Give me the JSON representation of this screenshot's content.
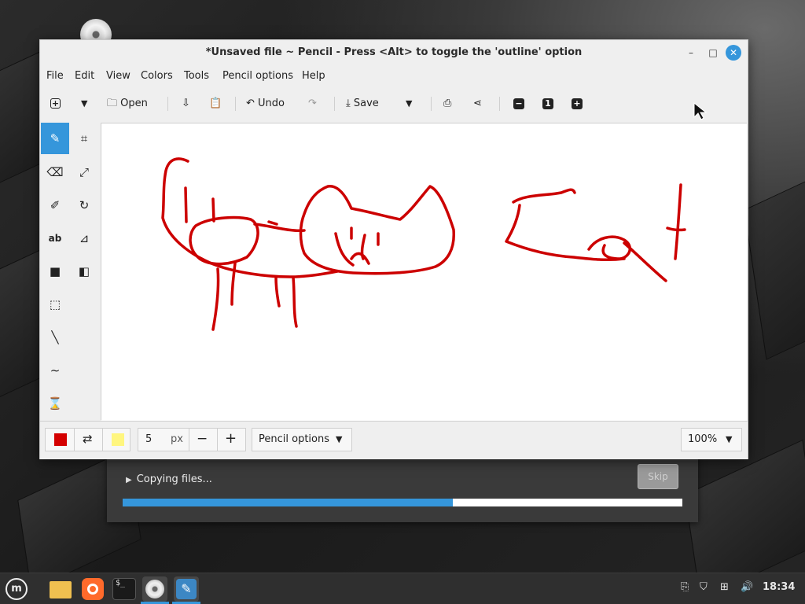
{
  "window": {
    "title": "*Unsaved file ~ Pencil - Press <Alt> to toggle the 'outline' option",
    "minimize": "–",
    "maximize": "□",
    "close": "✕"
  },
  "menu": [
    "File",
    "Edit",
    "View",
    "Colors",
    "Tools",
    "Pencil options",
    "Help"
  ],
  "toolbar": {
    "open": "Open",
    "undo": "Undo",
    "save": "Save"
  },
  "tools": [
    {
      "name": "pencil",
      "icon": "✎"
    },
    {
      "name": "crop",
      "icon": "⌗"
    },
    {
      "name": "eraser",
      "icon": "⌫"
    },
    {
      "name": "scale",
      "icon": "⤢"
    },
    {
      "name": "highlighter",
      "icon": "✐"
    },
    {
      "name": "rotate",
      "icon": "↻"
    },
    {
      "name": "text",
      "icon": "ab"
    },
    {
      "name": "skew",
      "icon": "⊿"
    },
    {
      "name": "rectangle",
      "icon": "■"
    },
    {
      "name": "filters",
      "icon": "◧"
    },
    {
      "name": "selection",
      "icon": "⬚"
    },
    {
      "name": "line",
      "icon": "╲"
    },
    {
      "name": "curve",
      "icon": "∼"
    },
    {
      "name": "free-shape",
      "icon": "⌛"
    }
  ],
  "bottom": {
    "primary_color": "#d40000",
    "secondary_color": "#fff67f",
    "size_value": "5",
    "size_unit": "px",
    "minus": "−",
    "plus": "+",
    "options_label": "Pencil options",
    "zoom": "100%"
  },
  "copy_dialog": {
    "label": "Copying files...",
    "skip": "Skip",
    "progress": 0.59
  },
  "taskbar": {
    "clock": "18:34"
  },
  "colors": {
    "accent": "#3596db",
    "drawing": "#cc0000"
  }
}
